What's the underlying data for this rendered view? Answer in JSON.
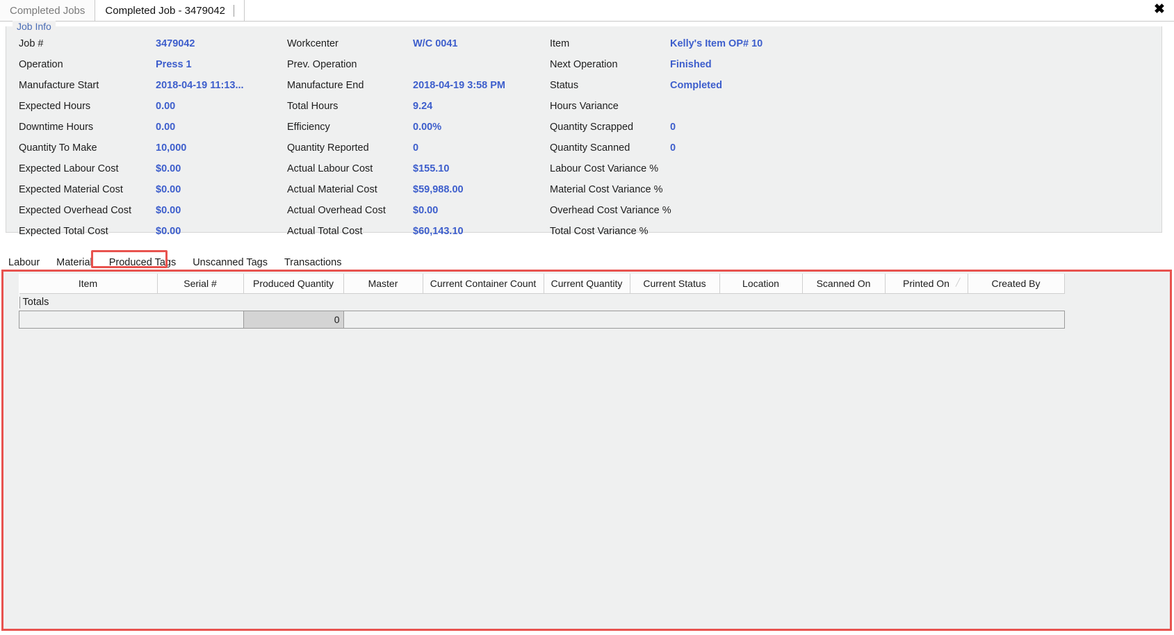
{
  "window": {
    "tabs": [
      {
        "label": "Completed Jobs",
        "active": false
      },
      {
        "label": "Completed Job - 3479042",
        "active": true
      }
    ],
    "close_icon": "✖"
  },
  "job_info": {
    "legend": "Job Info",
    "rows": [
      {
        "c1_label": "Job #",
        "c1_value": "3479042",
        "c2_label": "Workcenter",
        "c2_value": "W/C 0041",
        "c3_label": "Item",
        "c3_value": "Kelly's Item OP# 10"
      },
      {
        "c1_label": "Operation",
        "c1_value": "Press 1",
        "c2_label": "Prev. Operation",
        "c2_value": "",
        "c3_label": "Next Operation",
        "c3_value": "Finished"
      },
      {
        "c1_label": "Manufacture Start",
        "c1_value": "2018-04-19 11:13...",
        "c2_label": "Manufacture End",
        "c2_value": "2018-04-19 3:58 PM",
        "c3_label": "Status",
        "c3_value": "Completed"
      },
      {
        "c1_label": "Expected Hours",
        "c1_value": "0.00",
        "c2_label": "Total Hours",
        "c2_value": "9.24",
        "c3_label": "Hours Variance",
        "c3_value": ""
      },
      {
        "c1_label": "Downtime Hours",
        "c1_value": "0.00",
        "c2_label": "Efficiency",
        "c2_value": "0.00%",
        "c3_label": "Quantity Scrapped",
        "c3_value": "0"
      },
      {
        "c1_label": "Quantity To Make",
        "c1_value": "10,000",
        "c2_label": "Quantity Reported",
        "c2_value": "0",
        "c3_label": "Quantity Scanned",
        "c3_value": "0"
      },
      {
        "c1_label": "Expected Labour Cost",
        "c1_value": "$0.00",
        "c2_label": "Actual Labour Cost",
        "c2_value": "$155.10",
        "c3_label": "Labour Cost Variance %",
        "c3_value": ""
      },
      {
        "c1_label": "Expected Material Cost",
        "c1_value": "$0.00",
        "c2_label": "Actual Material Cost",
        "c2_value": "$59,988.00",
        "c3_label": "Material Cost Variance %",
        "c3_value": ""
      },
      {
        "c1_label": "Expected Overhead Cost",
        "c1_value": "$0.00",
        "c2_label": "Actual Overhead Cost",
        "c2_value": "$0.00",
        "c3_label": "Overhead Cost Variance %",
        "c3_value": ""
      },
      {
        "c1_label": "Expected Total Cost",
        "c1_value": "$0.00",
        "c2_label": "Actual Total Cost",
        "c2_value": "$60,143.10",
        "c3_label": "Total Cost Variance %",
        "c3_value": ""
      }
    ]
  },
  "sub_tabs": [
    {
      "label": "Labour",
      "selected": false
    },
    {
      "label": "Material",
      "selected": false
    },
    {
      "label": "Produced Tags",
      "selected": true
    },
    {
      "label": "Unscanned Tags",
      "selected": false
    },
    {
      "label": "Transactions",
      "selected": false
    }
  ],
  "produced_tags_grid": {
    "columns": [
      "Item",
      "Serial #",
      "Produced Quantity",
      "Master",
      "Current Container Count",
      "Current Quantity",
      "Current Status",
      "Location",
      "Scanned On",
      "Printed On",
      "Created By"
    ],
    "sort_column": "Printed On",
    "sort_indicator": "╱",
    "totals_label": "Totals",
    "totals_produced_quantity": "0",
    "rows": []
  },
  "colors": {
    "value_blue": "#3d5ecc",
    "legend_blue": "#4b6db5",
    "highlight_red": "#e8534f",
    "panel_bg": "#eff0f0"
  }
}
